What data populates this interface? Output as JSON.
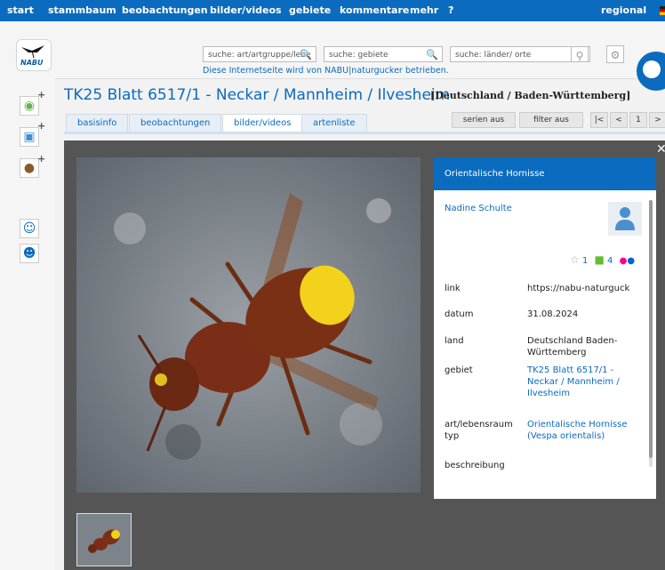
{
  "nav": {
    "items": [
      "start",
      "stammbaum",
      "beobachtungen",
      "bilder/videos",
      "gebiete",
      "kommentare",
      "mehr",
      "?"
    ],
    "regional": "regional"
  },
  "header": {
    "logo_text": "NABU",
    "search_art_placeholder": "suche: art/artgruppe/lebe",
    "search_gebiete_placeholder": "suche: gebiete",
    "search_laender_placeholder": "suche: länder/ orte",
    "tagline": "Diese Internetseite wird von NABU|naturgucker betrieben."
  },
  "page": {
    "title": "TK25 Blatt 6517/1 - Neckar / Mannheim / Ilvesheim",
    "subtitle": "[Deutschland / Baden-Württemberg]"
  },
  "tabs": [
    "basisinfo",
    "beobachtungen",
    "bilder/videos",
    "artenliste"
  ],
  "active_tab": "bilder/videos",
  "controls": {
    "serien": "serien aus",
    "filter": "filter aus",
    "first": "|<",
    "prev": "<",
    "page": "1",
    "next": ">"
  },
  "panel": {
    "title": "Orientalische Hornisse",
    "author": "Nadine Schulte",
    "stars": "1",
    "comments": "4",
    "rows": [
      {
        "label": "link",
        "value": "https://nabu-naturguck"
      },
      {
        "label": "datum",
        "value": "31.08.2024"
      },
      {
        "label": "land",
        "value": "Deutschland Baden-Württemberg"
      },
      {
        "label": "gebiet",
        "value": "TK25 Blatt 6517/1 - Neckar / Mannheim / Ilvesheim"
      },
      {
        "label": "art/lebensraumtyp",
        "value": "Orientalische Hornisse (Vespa orientalis)"
      },
      {
        "label": "beschreibung",
        "value": ""
      }
    ]
  },
  "colors": {
    "primary": "#0a6bbf",
    "viewer_bg": "#555555",
    "flickr_blue": "#0063dc",
    "flickr_pink": "#ff0084",
    "comment_green": "#66bb33"
  }
}
